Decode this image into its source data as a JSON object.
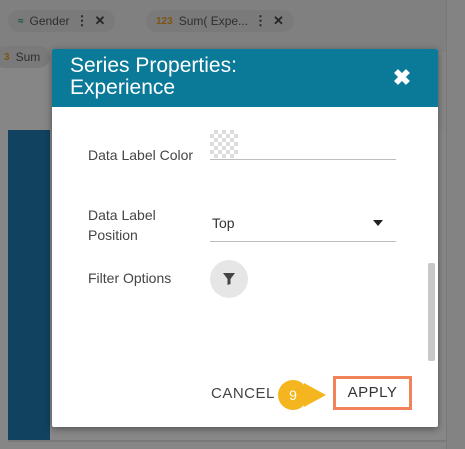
{
  "background": {
    "chips": [
      {
        "type_tag": "",
        "label": "Gender"
      },
      {
        "type_tag": "123",
        "label": "Sum( Expe..."
      },
      {
        "type_tag": "3",
        "label": "Sum"
      }
    ]
  },
  "dialog": {
    "title_line1": "Series Properties:",
    "title_line2": "Experience",
    "fields": {
      "data_label_color": {
        "label": "Data Label Color"
      },
      "data_label_position": {
        "label_line1": "Data Label",
        "label_line2": "Position",
        "value": "Top"
      },
      "filter_options": {
        "label": "Filter Options"
      }
    },
    "buttons": {
      "cancel": "CANCEL",
      "apply": "APPLY"
    },
    "tutorial_step": "9"
  },
  "colors": {
    "header": "#0b7a99",
    "highlight_border": "#f0835a",
    "step_badge": "#f5b51e"
  },
  "icons": {
    "close": "close-icon",
    "filter": "filter-icon",
    "dropdown": "chevron-down-icon"
  }
}
